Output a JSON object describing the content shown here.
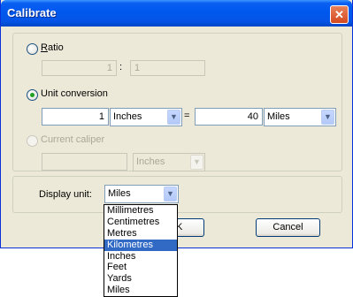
{
  "window": {
    "title": "Calibrate"
  },
  "ratio": {
    "label": "Ratio",
    "left_value": "1",
    "separator": ":",
    "right_value": "1"
  },
  "unit_conversion": {
    "label": "Unit conversion",
    "from_value": "1",
    "from_unit": "Inches",
    "equals": "=",
    "to_value": "40",
    "to_unit": "Miles"
  },
  "current_caliper": {
    "label": "Current caliper",
    "value": "",
    "unit": "Inches"
  },
  "display_unit": {
    "label": "Display unit:",
    "selected": "Miles",
    "options": [
      "Millimetres",
      "Centimetres",
      "Metres",
      "Kilometres",
      "Inches",
      "Feet",
      "Yards",
      "Miles"
    ],
    "highlighted": "Kilometres"
  },
  "buttons": {
    "ok": "K",
    "cancel": "Cancel"
  }
}
